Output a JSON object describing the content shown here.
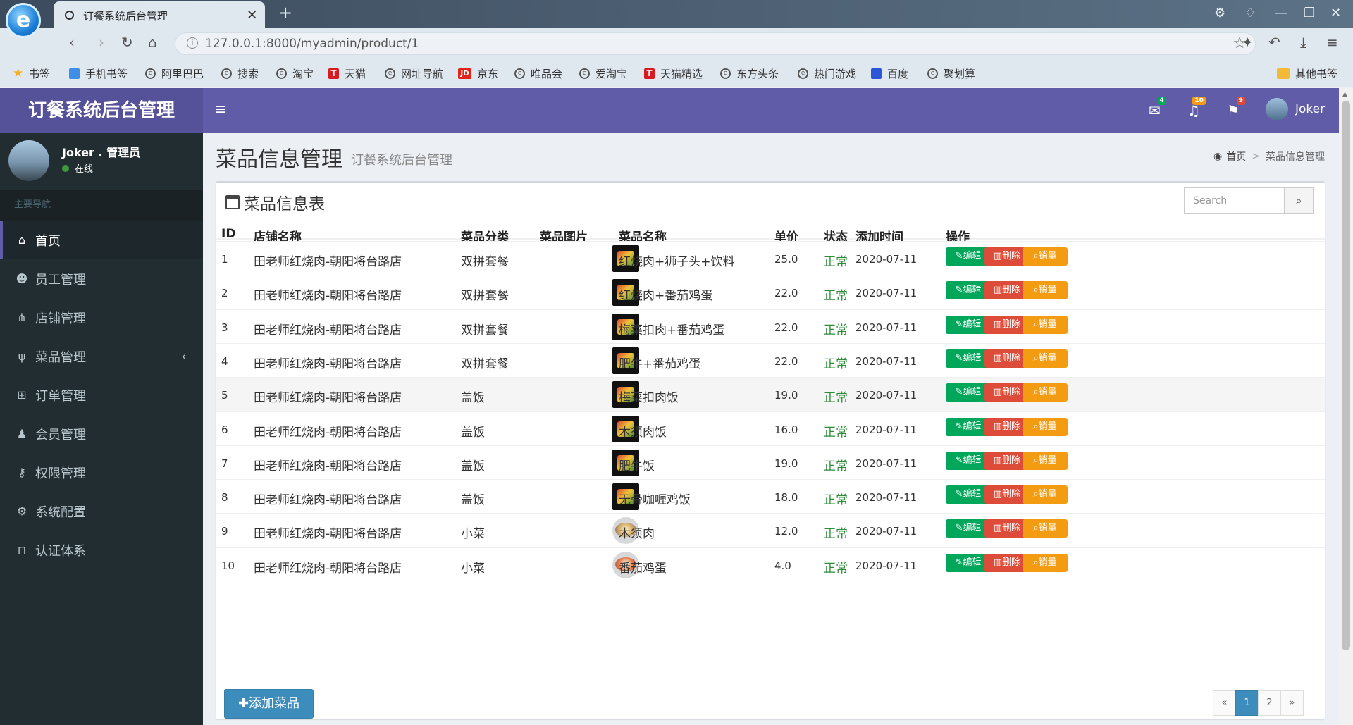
{
  "browser": {
    "tab_title": "订餐系统后台管理",
    "url": "127.0.0.1:8000/myadmin/product/1",
    "bookmarks": [
      "书签",
      "手机书签",
      "阿里巴巴",
      "搜索",
      "淘宝",
      "天猫",
      "网址导航",
      "京东",
      "唯品会",
      "爱淘宝",
      "天猫精选",
      "东方头条",
      "热门游戏",
      "百度",
      "聚划算"
    ],
    "other_bookmarks": "其他书签"
  },
  "app": {
    "logo": "订餐系统后台管理",
    "user": "Joker",
    "badges": {
      "mail": "4",
      "bell": "10",
      "flag": "9"
    },
    "colors": {
      "header": "#605ca8",
      "sidebar": "#222d32",
      "success": "#00a65a",
      "danger": "#dd4b39",
      "warning": "#f39c12",
      "primary": "#3c8dbc"
    }
  },
  "sidebar": {
    "user_name": "Joker . 管理员",
    "status": "在线",
    "nav_header": "主要导航",
    "items": [
      {
        "label": "首页",
        "icon": "home-icon"
      },
      {
        "label": "员工管理",
        "icon": "users-icon"
      },
      {
        "label": "店铺管理",
        "icon": "sitemap-icon"
      },
      {
        "label": "菜品管理",
        "icon": "cutlery-icon"
      },
      {
        "label": "订单管理",
        "icon": "cart-icon"
      },
      {
        "label": "会员管理",
        "icon": "user-icon"
      },
      {
        "label": "权限管理",
        "icon": "key-icon"
      },
      {
        "label": "系统配置",
        "icon": "gear-icon"
      },
      {
        "label": "认证体系",
        "icon": "unlock-icon"
      }
    ]
  },
  "page": {
    "title": "菜品信息管理",
    "subtitle": "订餐系统后台管理",
    "breadcrumb_home": "首页",
    "breadcrumb_current": "菜品信息管理"
  },
  "table": {
    "title": "菜品信息表",
    "search_placeholder": "Search",
    "headers": [
      "ID",
      "店铺名称",
      "菜品分类",
      "菜品图片",
      "菜品名称",
      "单价",
      "状态",
      "添加时间",
      "操作"
    ],
    "rows": [
      {
        "id": "1",
        "shop": "田老师红烧肉-朝阳将台路店",
        "category": "双拼套餐",
        "name": "红烧肉+狮子头+饮料",
        "price": "25.0",
        "status": "正常",
        "date": "2020-07-11"
      },
      {
        "id": "2",
        "shop": "田老师红烧肉-朝阳将台路店",
        "category": "双拼套餐",
        "name": "红烧肉+番茄鸡蛋",
        "price": "22.0",
        "status": "正常",
        "date": "2020-07-11"
      },
      {
        "id": "3",
        "shop": "田老师红烧肉-朝阳将台路店",
        "category": "双拼套餐",
        "name": "梅菜扣肉+番茄鸡蛋",
        "price": "22.0",
        "status": "正常",
        "date": "2020-07-11"
      },
      {
        "id": "4",
        "shop": "田老师红烧肉-朝阳将台路店",
        "category": "双拼套餐",
        "name": "肥牛+番茄鸡蛋",
        "price": "22.0",
        "status": "正常",
        "date": "2020-07-11"
      },
      {
        "id": "5",
        "shop": "田老师红烧肉-朝阳将台路店",
        "category": "盖饭",
        "name": "梅菜扣肉饭",
        "price": "19.0",
        "status": "正常",
        "date": "2020-07-11"
      },
      {
        "id": "6",
        "shop": "田老师红烧肉-朝阳将台路店",
        "category": "盖饭",
        "name": "木须肉饭",
        "price": "16.0",
        "status": "正常",
        "date": "2020-07-11"
      },
      {
        "id": "7",
        "shop": "田老师红烧肉-朝阳将台路店",
        "category": "盖饭",
        "name": "肥牛饭",
        "price": "19.0",
        "status": "正常",
        "date": "2020-07-11"
      },
      {
        "id": "8",
        "shop": "田老师红烧肉-朝阳将台路店",
        "category": "盖饭",
        "name": "无骨咖喱鸡饭",
        "price": "18.0",
        "status": "正常",
        "date": "2020-07-11"
      },
      {
        "id": "9",
        "shop": "田老师红烧肉-朝阳将台路店",
        "category": "小菜",
        "name": "木须肉",
        "price": "12.0",
        "status": "正常",
        "date": "2020-07-11"
      },
      {
        "id": "10",
        "shop": "田老师红烧肉-朝阳将台路店",
        "category": "小菜",
        "name": "番茄鸡蛋",
        "price": "4.0",
        "status": "正常",
        "date": "2020-07-11"
      }
    ],
    "action_labels": {
      "edit": "编辑",
      "delete": "删除",
      "sales": "销量"
    }
  },
  "footer": {
    "add_button": "添加菜品",
    "pager": [
      "«",
      "1",
      "2",
      "»"
    ],
    "current_page": "1"
  }
}
